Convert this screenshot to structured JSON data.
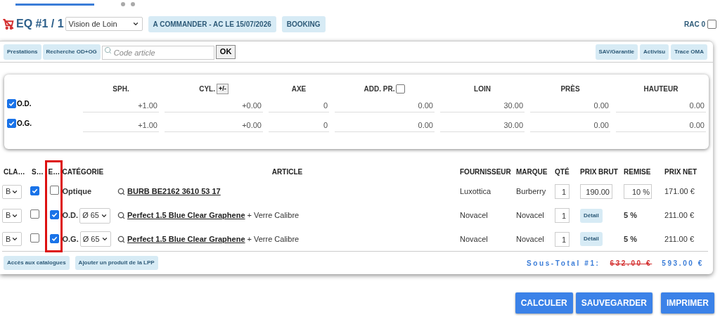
{
  "header": {
    "title": "EQ #1 / 1",
    "vision_select": "Vision de Loin",
    "tags": [
      "A COMMANDER - AC LE 15/07/2026",
      "BOOKING"
    ],
    "rac": {
      "label": "RAC 0",
      "checked": false
    }
  },
  "toolbar": {
    "left_buttons": [
      "Prestations",
      "Recherche OD+OG"
    ],
    "search": {
      "placeholder": "Code article",
      "button": "OK"
    },
    "right_buttons": [
      "SAV/Garantie",
      "Activisu",
      "Trace OMA"
    ]
  },
  "prescription": {
    "columns": [
      {
        "label": "SPH.",
        "kind": "plain"
      },
      {
        "label": "CYL.",
        "kind": "toggle",
        "button": "+/-"
      },
      {
        "label": "AXE",
        "kind": "plain"
      },
      {
        "label": "ADD. PR.",
        "kind": "checkbox",
        "checked": false
      },
      {
        "label": "LOIN",
        "kind": "plain"
      },
      {
        "label": "PRÈS",
        "kind": "plain"
      },
      {
        "label": "HAUTEUR",
        "kind": "plain"
      }
    ],
    "rows": [
      {
        "label": "O.D.",
        "checked": true,
        "values": [
          "+1.00",
          "+0.00",
          "0",
          "0.00",
          "30.00",
          "0.00",
          "0.00"
        ]
      },
      {
        "label": "O.G.",
        "checked": true,
        "values": [
          "+1.00",
          "+0.00",
          "0",
          "0.00",
          "30.00",
          "0.00",
          "0.00"
        ]
      }
    ]
  },
  "articles": {
    "columns": [
      {
        "label": "CLA…",
        "highlighted": false
      },
      {
        "label": "S…",
        "highlighted": false
      },
      {
        "label": "E…",
        "highlighted": true
      },
      {
        "label": "CATÉGORIE",
        "highlighted": false
      },
      {
        "label": "ARTICLE",
        "highlighted": false
      },
      {
        "label": "FOURNISSEUR",
        "highlighted": false
      },
      {
        "label": "MARQUE",
        "highlighted": false
      },
      {
        "label": "QTÉ",
        "highlighted": false
      },
      {
        "label": "PRIX BRUT",
        "highlighted": false
      },
      {
        "label": "REMISE",
        "highlighted": false
      },
      {
        "label": "PRIX NET",
        "highlighted": false
      }
    ],
    "rows": [
      {
        "kind": "frame",
        "class": "B",
        "s_checked": true,
        "e_checked": false,
        "category": "Optique",
        "article": "BURB BE2162 3610 53 17",
        "supplier": "Luxottica",
        "brand": "Burberry",
        "qty": "1",
        "price": "190.00",
        "discount": "10 %",
        "net": "171.00 €"
      },
      {
        "kind": "lens",
        "class": "B",
        "s_checked": false,
        "e_checked": true,
        "eye": "O.D.",
        "diameter": "Ø 65",
        "article": "Perfect 1.5 Blue Clear Graphene",
        "suffix": "+ Verre Calibre",
        "supplier": "Novacel",
        "brand": "Novacel",
        "qty": "1",
        "price": "Détail",
        "discount": "5 %",
        "net": "211.00 €"
      },
      {
        "kind": "lens",
        "class": "B",
        "s_checked": false,
        "e_checked": true,
        "eye": "O.G.",
        "diameter": "Ø 65",
        "article": "Perfect 1.5 Blue Clear Graphene",
        "suffix": "+ Verre Calibre",
        "supplier": "Novacel",
        "brand": "Novacel",
        "qty": "1",
        "price": "Détail",
        "discount": "5 %",
        "net": "211.00 €"
      }
    ]
  },
  "footer": {
    "buttons": [
      "Accès aux catalogues",
      "Ajouter un produit de la LPP"
    ],
    "subtotal_label": "Sous-Total #1:",
    "old_total": "632.00 €",
    "new_total": "593.00 €"
  },
  "actions": [
    "CALCULER",
    "SAUVEGARDER",
    "IMPRIMER"
  ]
}
